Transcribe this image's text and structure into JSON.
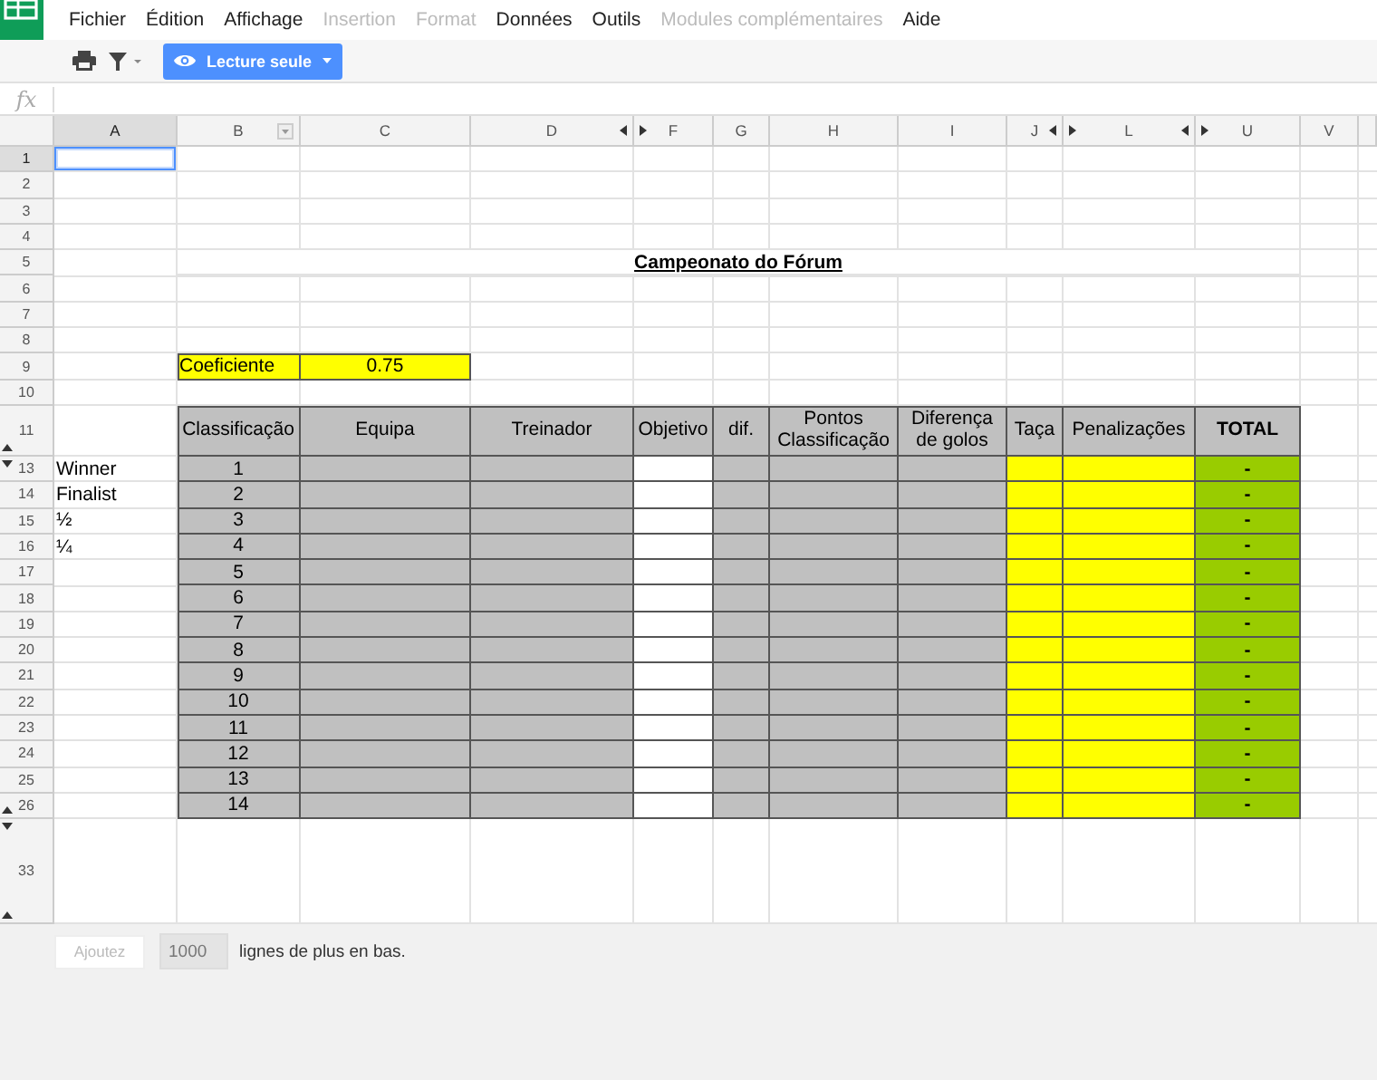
{
  "menu": [
    {
      "label": "Fichier",
      "disabled": false
    },
    {
      "label": "Édition",
      "disabled": false
    },
    {
      "label": "Affichage",
      "disabled": false
    },
    {
      "label": "Insertion",
      "disabled": true
    },
    {
      "label": "Format",
      "disabled": true
    },
    {
      "label": "Données",
      "disabled": false
    },
    {
      "label": "Outils",
      "disabled": false
    },
    {
      "label": "Modules complémentaires",
      "disabled": true
    },
    {
      "label": "Aide",
      "disabled": false
    }
  ],
  "toolbar": {
    "mode_button": "Lecture seule"
  },
  "formula_bar": {
    "label": "fx"
  },
  "columns": [
    {
      "label": "A",
      "selected": true,
      "filter": false,
      "hidden_left": false,
      "hidden_right": false
    },
    {
      "label": "B",
      "selected": false,
      "filter": true,
      "hidden_left": false,
      "hidden_right": false
    },
    {
      "label": "C",
      "selected": false,
      "filter": false,
      "hidden_left": false,
      "hidden_right": false
    },
    {
      "label": "D",
      "selected": false,
      "filter": false,
      "hidden_left": false,
      "hidden_right": true
    },
    {
      "label": "F",
      "selected": false,
      "filter": false,
      "hidden_left": true,
      "hidden_right": false
    },
    {
      "label": "G",
      "selected": false,
      "filter": false,
      "hidden_left": false,
      "hidden_right": false
    },
    {
      "label": "H",
      "selected": false,
      "filter": false,
      "hidden_left": false,
      "hidden_right": false
    },
    {
      "label": "I",
      "selected": false,
      "filter": false,
      "hidden_left": false,
      "hidden_right": false
    },
    {
      "label": "J",
      "selected": false,
      "filter": false,
      "hidden_left": false,
      "hidden_right": true
    },
    {
      "label": "L",
      "selected": false,
      "filter": false,
      "hidden_left": true,
      "hidden_right": true
    },
    {
      "label": "U",
      "selected": false,
      "filter": false,
      "hidden_left": true,
      "hidden_right": false
    },
    {
      "label": "V",
      "selected": false,
      "filter": false,
      "hidden_left": false,
      "hidden_right": false
    }
  ],
  "rows": [
    {
      "number": "1",
      "selected": true,
      "kind": "blank",
      "hidden_before": false,
      "hidden_after": false
    },
    {
      "number": "2",
      "selected": false,
      "kind": "blank",
      "hidden_before": false,
      "hidden_after": false
    },
    {
      "number": "3",
      "selected": false,
      "kind": "blank",
      "hidden_before": false,
      "hidden_after": false
    },
    {
      "number": "4",
      "selected": false,
      "kind": "blank",
      "hidden_before": false,
      "hidden_after": false
    },
    {
      "number": "5",
      "selected": false,
      "kind": "title",
      "text": "Campeonato do Fórum",
      "hidden_before": false,
      "hidden_after": false
    },
    {
      "number": "6",
      "selected": false,
      "kind": "blank",
      "hidden_before": false,
      "hidden_after": false
    },
    {
      "number": "7",
      "selected": false,
      "kind": "blank",
      "hidden_before": false,
      "hidden_after": false
    },
    {
      "number": "8",
      "selected": false,
      "kind": "blank",
      "hidden_before": false,
      "hidden_after": false
    },
    {
      "number": "9",
      "selected": false,
      "kind": "coefficient",
      "coefficient_label": "Coeficiente",
      "coefficient_value": "0.75",
      "hidden_before": false,
      "hidden_after": false
    },
    {
      "number": "10",
      "selected": false,
      "kind": "blank",
      "hidden_before": false,
      "hidden_after": false
    },
    {
      "number": "11",
      "selected": false,
      "kind": "header",
      "hidden_before": false,
      "hidden_after": true,
      "cells": [
        {
          "text": "Classificação",
          "kind": "plain"
        },
        {
          "text": "Equipa",
          "kind": "plain"
        },
        {
          "text": "Treinador",
          "kind": "plain"
        },
        {
          "text": "Objetivo",
          "kind": "input"
        },
        {
          "text": "dif.",
          "kind": "plain"
        },
        {
          "text": "Pontos Classificação",
          "kind": "plain"
        },
        {
          "text": "Diferença de golos",
          "kind": "plain"
        },
        {
          "text": "Taça",
          "kind": "highlight"
        },
        {
          "text": "Penalizações",
          "kind": "highlight"
        },
        {
          "text": "TOTAL",
          "kind": "total"
        }
      ]
    },
    {
      "number": "13",
      "selected": false,
      "kind": "entry",
      "label": "Winner",
      "rank": "1",
      "total": "-",
      "hidden_before": true,
      "hidden_after": false
    },
    {
      "number": "14",
      "selected": false,
      "kind": "entry",
      "label": "Finalist",
      "rank": "2",
      "total": "-",
      "hidden_before": false,
      "hidden_after": false
    },
    {
      "number": "15",
      "selected": false,
      "kind": "entry",
      "label": "½",
      "rank": "3",
      "total": "-",
      "hidden_before": false,
      "hidden_after": false
    },
    {
      "number": "16",
      "selected": false,
      "kind": "entry",
      "label": "¼",
      "rank": "4",
      "total": "-",
      "hidden_before": false,
      "hidden_after": false
    },
    {
      "number": "17",
      "selected": false,
      "kind": "entry",
      "rank": "5",
      "total": "-",
      "hidden_before": false,
      "hidden_after": false
    },
    {
      "number": "18",
      "selected": false,
      "kind": "entry",
      "rank": "6",
      "total": "-",
      "hidden_before": false,
      "hidden_after": false
    },
    {
      "number": "19",
      "selected": false,
      "kind": "entry",
      "rank": "7",
      "total": "-",
      "hidden_before": false,
      "hidden_after": false
    },
    {
      "number": "20",
      "selected": false,
      "kind": "entry",
      "rank": "8",
      "total": "-",
      "hidden_before": false,
      "hidden_after": false
    },
    {
      "number": "21",
      "selected": false,
      "kind": "entry",
      "rank": "9",
      "total": "-",
      "hidden_before": false,
      "hidden_after": false
    },
    {
      "number": "22",
      "selected": false,
      "kind": "entry",
      "rank": "10",
      "total": "-",
      "hidden_before": false,
      "hidden_after": false
    },
    {
      "number": "23",
      "selected": false,
      "kind": "entry",
      "rank": "11",
      "total": "-",
      "hidden_before": false,
      "hidden_after": false
    },
    {
      "number": "24",
      "selected": false,
      "kind": "entry",
      "rank": "12",
      "total": "-",
      "hidden_before": false,
      "hidden_after": false
    },
    {
      "number": "25",
      "selected": false,
      "kind": "entry",
      "rank": "13",
      "total": "-",
      "hidden_before": false,
      "hidden_after": false
    },
    {
      "number": "26",
      "selected": false,
      "kind": "entry",
      "rank": "14",
      "total": "-",
      "hidden_before": false,
      "hidden_after": true
    },
    {
      "number": "33",
      "selected": false,
      "kind": "tall",
      "hidden_before": true,
      "hidden_after": true
    }
  ],
  "footer": {
    "button": "Ajoutez",
    "count": "1000",
    "text": "lignes de plus en bas."
  }
}
